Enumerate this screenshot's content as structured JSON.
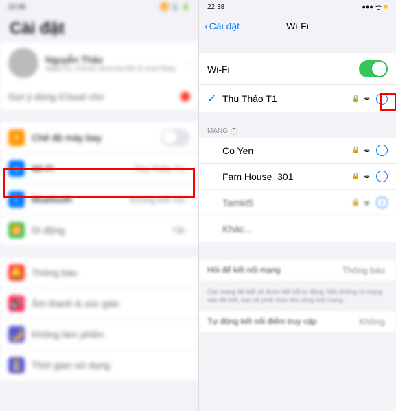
{
  "left": {
    "status_time": "22:38",
    "title": "Cài đặt",
    "profile": {
      "name": "Nguyễn Thảo",
      "subtitle": "Apple ID, iCloud, phương tiện & mua hàng"
    },
    "suggestion_label": "Gợi ý dùng iCloud cho",
    "rows": {
      "airplane": "Chế độ máy bay",
      "wifi_label": "Wi-Fi",
      "wifi_value": "Thu Thảo T1",
      "bluetooth_label": "Bluetooth",
      "bluetooth_value": "Không kết nối",
      "cellular_label": "Di động",
      "cellular_value": "Tắt",
      "notifications": "Thông báo",
      "sounds": "Âm thanh & xúc giác",
      "dnd": "Không làm phiền",
      "screentime": "Thời gian sử dụng"
    }
  },
  "right": {
    "status_time": "22:38",
    "back_label": "Cài đặt",
    "nav_title": "Wi-Fi",
    "wifi_toggle_label": "Wi-Fi",
    "connected_network": "Thu Thảo T1",
    "section_networks": "MẠNG",
    "networks": [
      {
        "name": "Co Yen"
      },
      {
        "name": "Fam House_301"
      },
      {
        "name": "Tamkt5"
      },
      {
        "name": "Khác..."
      }
    ],
    "ask_join_label": "Hỏi để kết nối mạng",
    "ask_join_value": "Thông báo",
    "ask_join_desc": "Các mạng đã biết sẽ được kết nối tự động. Nếu không có mạng nào đã biết, bạn sẽ phải chọn thủ công một mạng.",
    "auto_hotspot_label": "Tự động kết nối điểm truy cập",
    "auto_hotspot_value": "Không"
  }
}
